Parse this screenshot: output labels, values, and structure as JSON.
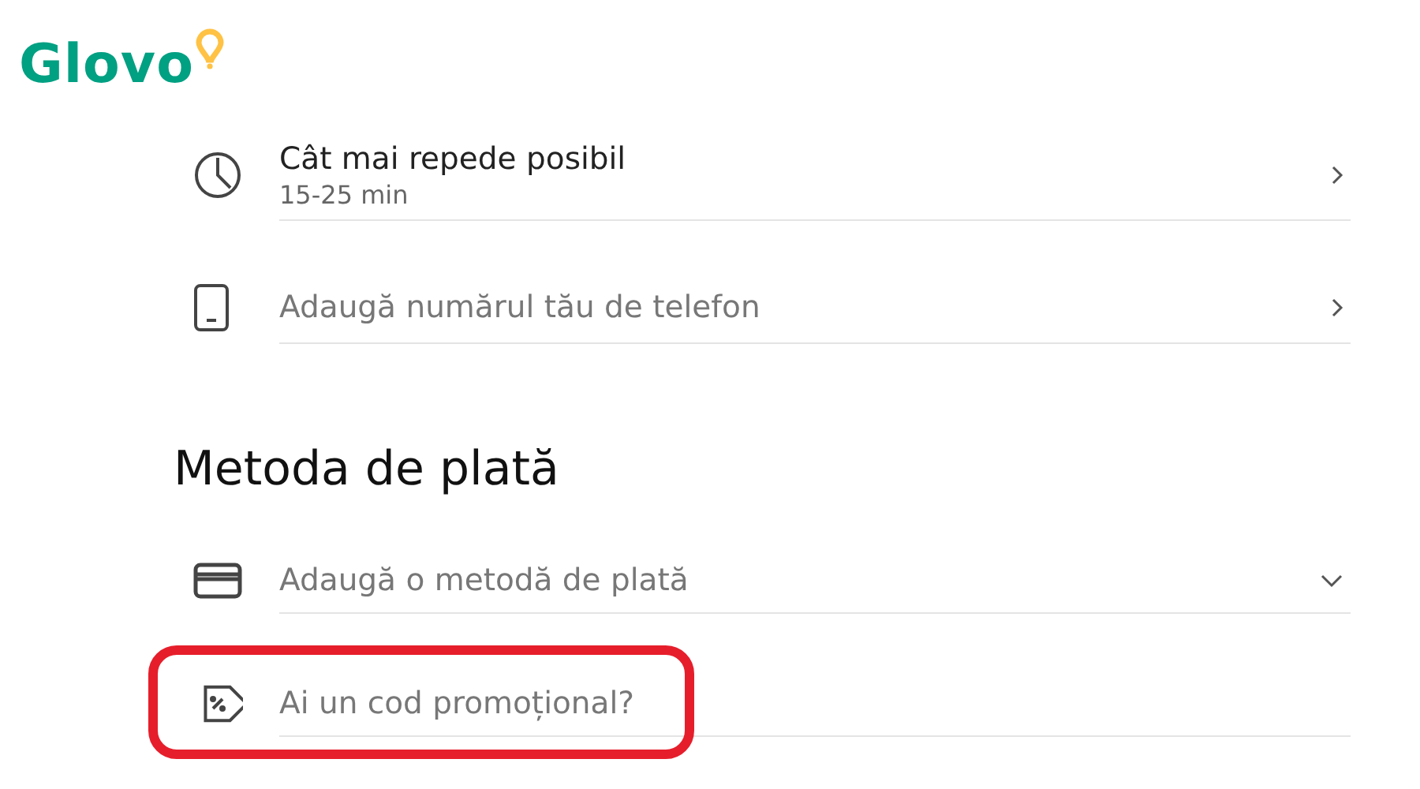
{
  "logo": {
    "text": "Glovo"
  },
  "delivery_rows": [
    {
      "kind": "time",
      "title": "Cât mai repede posibil",
      "subtitle": "15-25 min"
    },
    {
      "kind": "phone",
      "placeholder": "Adaugă numărul tău de telefon"
    }
  ],
  "payment": {
    "heading": "Metoda de plată",
    "rows": [
      {
        "kind": "card",
        "placeholder": "Adaugă o metodă de plată"
      },
      {
        "kind": "promo",
        "placeholder": "Ai un cod promoțional?",
        "highlighted": true
      }
    ]
  }
}
